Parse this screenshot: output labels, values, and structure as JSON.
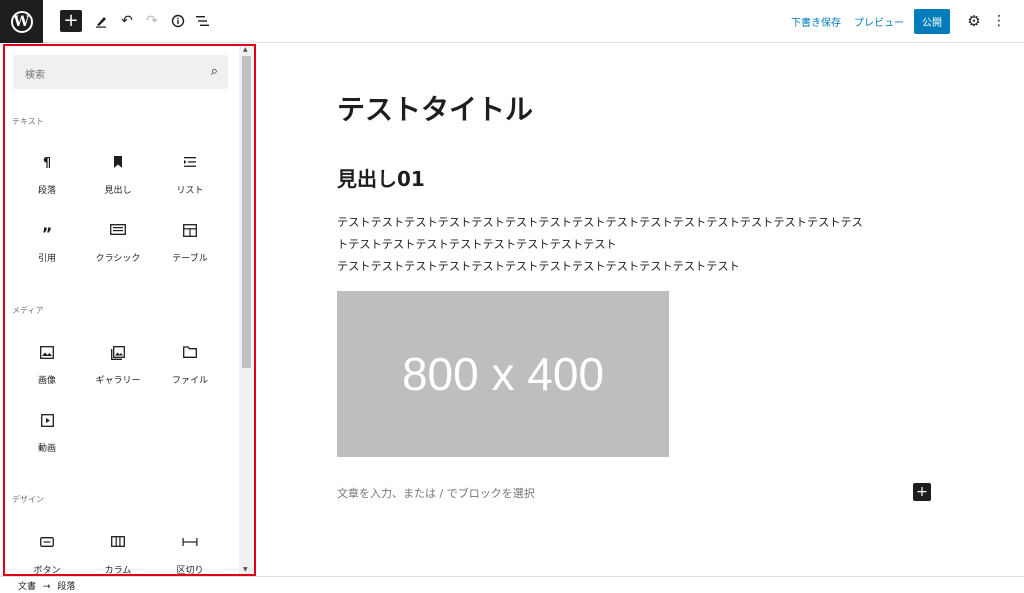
{
  "toolbar": {
    "logo": "W",
    "draft_save": "下書き保存",
    "preview": "プレビュー",
    "publish": "公開"
  },
  "inserter": {
    "search_placeholder": "検索",
    "categories": [
      {
        "label": "テキスト",
        "blocks": [
          {
            "label": "段落",
            "icon": "paragraph-icon"
          },
          {
            "label": "見出し",
            "icon": "bookmark-icon"
          },
          {
            "label": "リスト",
            "icon": "list-icon"
          },
          {
            "label": "引用",
            "icon": "quote-icon"
          },
          {
            "label": "クラシック",
            "icon": "keyboard-icon"
          },
          {
            "label": "テーブル",
            "icon": "table-icon"
          }
        ]
      },
      {
        "label": "メディア",
        "blocks": [
          {
            "label": "画像",
            "icon": "image-icon"
          },
          {
            "label": "ギャラリー",
            "icon": "gallery-icon"
          },
          {
            "label": "ファイル",
            "icon": "folder-icon"
          },
          {
            "label": "動画",
            "icon": "video-icon"
          }
        ]
      },
      {
        "label": "デザイン",
        "blocks": [
          {
            "label": "ボタン",
            "icon": "button-icon"
          },
          {
            "label": "カラム",
            "icon": "columns-icon"
          },
          {
            "label": "区切り",
            "icon": "separator-icon"
          }
        ]
      }
    ]
  },
  "editor": {
    "title": "テストタイトル",
    "heading": "見出し01",
    "paragraph_lines": [
      "テストテストテストテストテストテストテストテストテストテストテストテストテストテストテストテス",
      "トテストテストテストテストテストテストテストテスト",
      "テストテストテストテストテストテストテストテストテストテストテストテスト"
    ],
    "image_label": "800 x 400",
    "block_placeholder": "文章を入力、または / でブロックを選択"
  },
  "footer": {
    "breadcrumb_doc": "文書",
    "breadcrumb_sep": "→",
    "breadcrumb_block": "段落"
  }
}
